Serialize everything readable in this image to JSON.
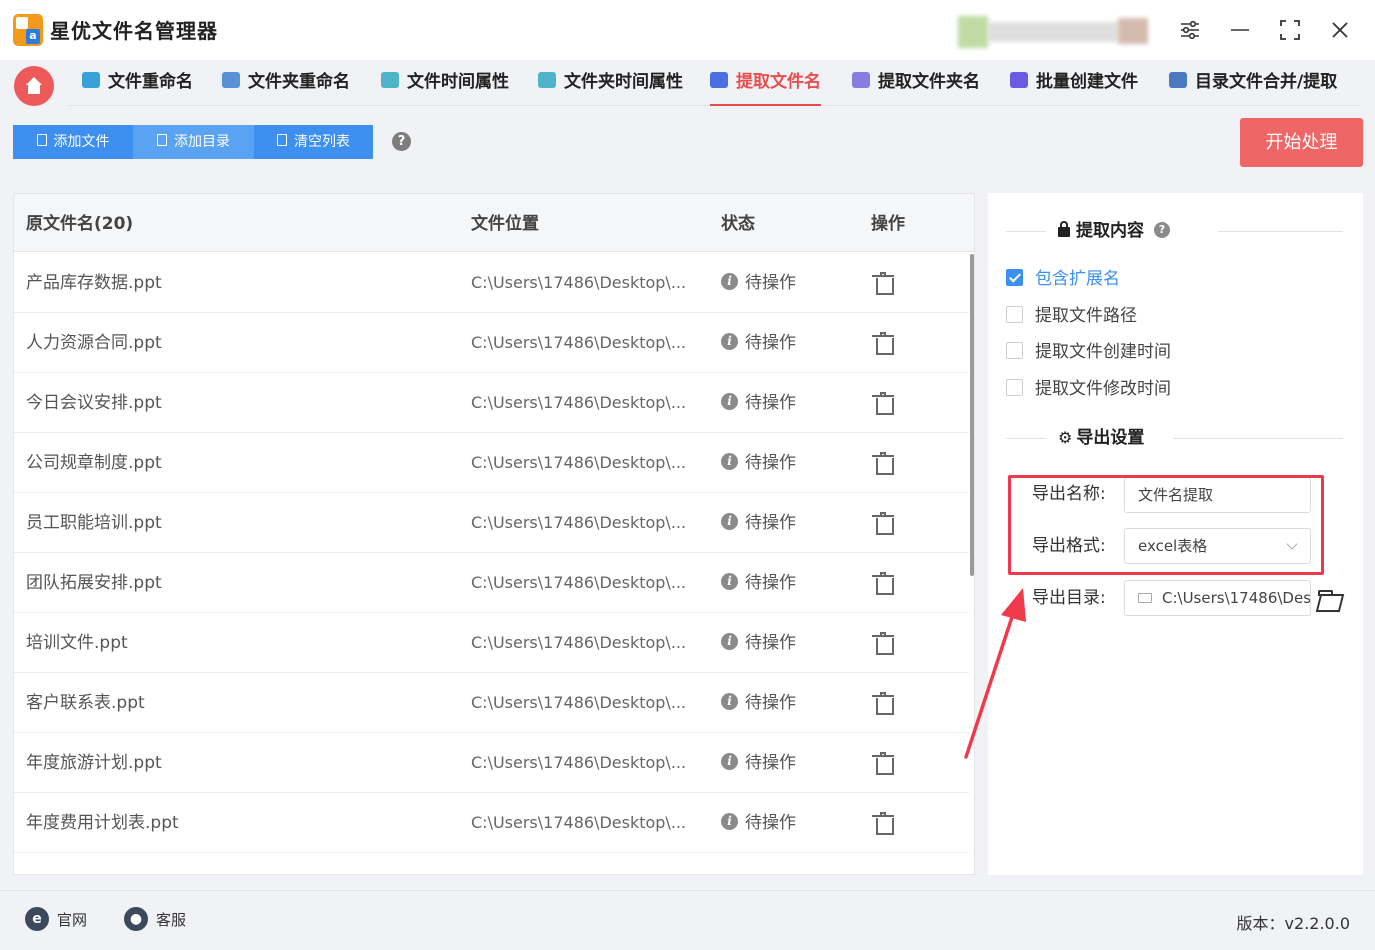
{
  "app": {
    "title": "星优文件名管理器"
  },
  "window_controls": [
    "settings-icon",
    "minimize-icon",
    "maximize-icon",
    "close-icon"
  ],
  "tabs": [
    {
      "label": "文件重命名",
      "icon": "rename-icon",
      "icon_color": "#3aa0d8"
    },
    {
      "label": "文件夹重命名",
      "icon": "folder-rename-icon",
      "icon_color": "#5b8fd6"
    },
    {
      "label": "文件时间属性",
      "icon": "file-time-icon",
      "icon_color": "#4fb3c9"
    },
    {
      "label": "文件夹时间属性",
      "icon": "folder-time-icon",
      "icon_color": "#4fb3c9"
    },
    {
      "label": "提取文件名",
      "icon": "extract-name-icon",
      "icon_color": "#4a6fe0",
      "active": true
    },
    {
      "label": "提取文件夹名",
      "icon": "extract-folder-icon",
      "icon_color": "#8a7be0"
    },
    {
      "label": "批量创建文件",
      "icon": "batch-create-icon",
      "icon_color": "#6a5be0"
    },
    {
      "label": "目录文件合并/提取",
      "icon": "merge-icon",
      "icon_color": "#4a7ac0"
    }
  ],
  "toolbar": {
    "add_file": "添加文件",
    "add_dir": "添加目录",
    "clear_list": "清空列表",
    "help": "?",
    "start": "开始处理"
  },
  "table": {
    "headers": [
      "原文件名(20)",
      "文件位置",
      "状态",
      "操作"
    ],
    "rows": [
      {
        "name": "产品库存数据.ppt",
        "path": "C:\\Users\\17486\\Desktop\\...",
        "status": "待操作"
      },
      {
        "name": "人力资源合同.ppt",
        "path": "C:\\Users\\17486\\Desktop\\...",
        "status": "待操作"
      },
      {
        "name": "今日会议安排.ppt",
        "path": "C:\\Users\\17486\\Desktop\\...",
        "status": "待操作"
      },
      {
        "name": "公司规章制度.ppt",
        "path": "C:\\Users\\17486\\Desktop\\...",
        "status": "待操作"
      },
      {
        "name": "员工职能培训.ppt",
        "path": "C:\\Users\\17486\\Desktop\\...",
        "status": "待操作"
      },
      {
        "name": "团队拓展安排.ppt",
        "path": "C:\\Users\\17486\\Desktop\\...",
        "status": "待操作"
      },
      {
        "name": "培训文件.ppt",
        "path": "C:\\Users\\17486\\Desktop\\...",
        "status": "待操作"
      },
      {
        "name": "客户联系表.ppt",
        "path": "C:\\Users\\17486\\Desktop\\...",
        "status": "待操作"
      },
      {
        "name": "年度旅游计划.ppt",
        "path": "C:\\Users\\17486\\Desktop\\...",
        "status": "待操作"
      },
      {
        "name": "年度费用计划表.ppt",
        "path": "C:\\Users\\17486\\Desktop\\...",
        "status": "待操作"
      },
      {
        "name": "",
        "path": "",
        "status": ""
      }
    ]
  },
  "extract": {
    "title": "提取内容",
    "help": "?",
    "options": [
      {
        "label": "包含扩展名",
        "checked": true
      },
      {
        "label": "提取文件路径",
        "checked": false
      },
      {
        "label": "提取文件创建时间",
        "checked": false
      },
      {
        "label": "提取文件修改时间",
        "checked": false
      }
    ]
  },
  "export": {
    "title": "导出设置",
    "name_label": "导出名称:",
    "name_value": "文件名提取",
    "format_label": "导出格式:",
    "format_value": "excel表格",
    "dir_label": "导出目录:",
    "dir_value": "C:\\Users\\17486\\Des"
  },
  "footer": {
    "website": "官网",
    "website_icon": "e",
    "service": "客服",
    "version": "版本：v2.2.0.0"
  },
  "colors": {
    "accent": "#3d8ff0",
    "active_tab": "#e94e4e",
    "start_button": "#ee6666",
    "highlight": "#ee3a4a"
  }
}
